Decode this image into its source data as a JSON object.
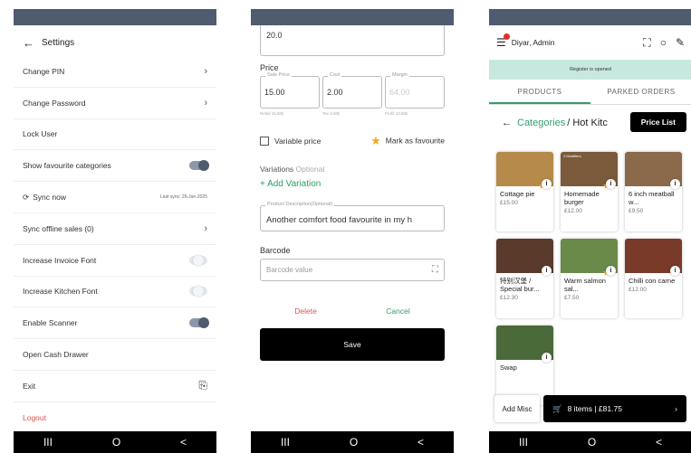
{
  "settings": {
    "title": "Settings",
    "items": [
      {
        "label": "Change PIN",
        "type": "chevron"
      },
      {
        "label": "Change Password",
        "type": "chevron"
      },
      {
        "label": "Lock User",
        "type": "plain"
      },
      {
        "label": "Show favourite categories",
        "type": "toggle",
        "on": true
      },
      {
        "label": "Sync now",
        "type": "sync",
        "note": "Last sync: 26-Jun-2025"
      },
      {
        "label": "Sync offline sales (0)",
        "type": "chevron"
      },
      {
        "label": "Increase Invoice Font",
        "type": "toggle",
        "on": false
      },
      {
        "label": "Increase Kitchen Font",
        "type": "toggle",
        "on": false
      },
      {
        "label": "Enable Scanner",
        "type": "toggle",
        "on": true
      },
      {
        "label": "Open Cash Drawer",
        "type": "plain"
      },
      {
        "label": "Exit",
        "type": "exit"
      },
      {
        "label": "Logout",
        "type": "logout"
      }
    ]
  },
  "product_form": {
    "top_field_value": "20.0",
    "price_label": "Price",
    "sale_price": {
      "legend": "Sale Price",
      "value": "15.00"
    },
    "cost": {
      "legend": "Cost",
      "value": "2.00"
    },
    "margin": {
      "legend": "Margin",
      "value": "64.00"
    },
    "mini_notes": [
      "Retail 15.50£",
      "Tax 2.50£",
      "Profit 10.50£"
    ],
    "variable_price_label": "Variable price",
    "favourite_label": "Mark as favourite",
    "variations_label": "Variations",
    "variations_optional": "Optional",
    "add_variation_label": "+ Add Variation",
    "description_legend": "Product Description(Optional)",
    "description_value": "Another comfort food favourite in my h",
    "barcode_label": "Barcode",
    "barcode_placeholder": "Barcode value",
    "delete_label": "Delete",
    "cancel_label": "Cancel",
    "save_label": "Save"
  },
  "pos": {
    "user": "Diyar, Admin",
    "banner": "Register is opened",
    "tabs": [
      "PRODUCTS",
      "PARKED ORDERS"
    ],
    "crumb_link": "Categories",
    "crumb_current": "/ Hot Kitc",
    "price_list_label": "Price List",
    "products": [
      {
        "name": "Cottage pie",
        "price": "£15.00",
        "color": "#b58a4a",
        "fav": true,
        "modifiers": ""
      },
      {
        "name": "Homemade burger",
        "price": "£12.00",
        "color": "#7a5a3a",
        "fav": true,
        "modifiers": "3 Modifiers"
      },
      {
        "name": "6 inch meatball w...",
        "price": "£9.50",
        "color": "#8a6a4a",
        "fav": false,
        "modifiers": ""
      },
      {
        "name": "特别汉堡 / Special bur...",
        "price": "£12.30",
        "color": "#5a3a2a",
        "fav": false,
        "modifiers": ""
      },
      {
        "name": "Warm salmon sal...",
        "price": "£7.50",
        "color": "#6a8a4a",
        "fav": true,
        "modifiers": ""
      },
      {
        "name": "Chilli con carne",
        "price": "£12.00",
        "color": "#7a3a2a",
        "fav": false,
        "modifiers": ""
      },
      {
        "name": "Swap",
        "price": "",
        "color": "#4a6a3a",
        "fav": false,
        "modifiers": ""
      }
    ],
    "add_misc_label": "Add Misc",
    "cart_label": "8 items | £81.75"
  },
  "nav": {
    "recents": "III",
    "home": "O",
    "back": "<"
  }
}
